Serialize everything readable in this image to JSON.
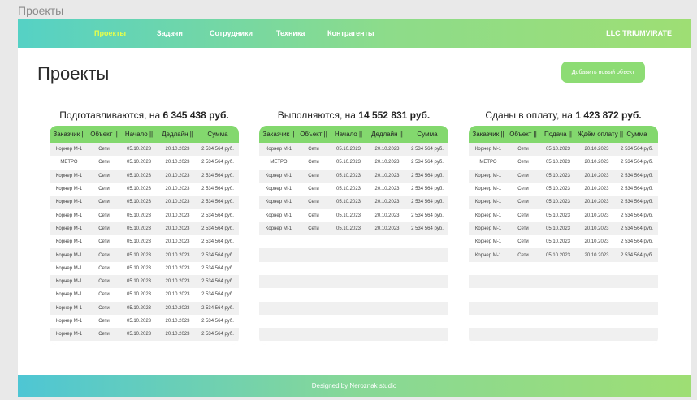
{
  "window_title": "Проекты",
  "nav": {
    "items": [
      {
        "label": "Проекты",
        "active": true
      },
      {
        "label": "Задачи",
        "active": false
      },
      {
        "label": "Сотрудники",
        "active": false
      },
      {
        "label": "Техника",
        "active": false
      },
      {
        "label": "Контрагенты",
        "active": false
      }
    ],
    "company": "LLC TRIUMVIRATE"
  },
  "page_title": "Проекты",
  "add_button": "Добавить новый объект",
  "panels": [
    {
      "title_prefix": "Подготавливаются, на ",
      "title_amount": "6 345 438 руб.",
      "columns": [
        "Заказчик ||",
        "Объект ||",
        "Начало ||",
        "Дедлайн ||",
        "Сумма"
      ],
      "total_rows": 16,
      "rows": [
        [
          "Корнер М-1",
          "Сети",
          "05.10.2023",
          "20.10.2023",
          "2 534 564 руб."
        ],
        [
          "МЕТРО",
          "Сети",
          "05.10.2023",
          "20.10.2023",
          "2 534 564 руб."
        ],
        [
          "Корнер М-1",
          "Сети",
          "05.10.2023",
          "20.10.2023",
          "2 534 564 руб."
        ],
        [
          "Корнер М-1",
          "Сети",
          "05.10.2023",
          "20.10.2023",
          "2 534 564 руб."
        ],
        [
          "Корнер М-1",
          "Сети",
          "05.10.2023",
          "20.10.2023",
          "2 534 564 руб."
        ],
        [
          "Корнер М-1",
          "Сети",
          "05.10.2023",
          "20.10.2023",
          "2 534 564 руб."
        ],
        [
          "Корнер М-1",
          "Сети",
          "05.10.2023",
          "20.10.2023",
          "2 534 564 руб."
        ],
        [
          "Корнер М-1",
          "Сети",
          "05.10.2023",
          "20.10.2023",
          "2 534 564 руб."
        ],
        [
          "Корнер М-1",
          "Сети",
          "05.10.2023",
          "20.10.2023",
          "2 534 564 руб."
        ],
        [
          "Корнер М-1",
          "Сети",
          "05.10.2023",
          "20.10.2023",
          "2 534 564 руб."
        ],
        [
          "Корнер М-1",
          "Сети",
          "05.10.2023",
          "20.10.2023",
          "2 534 564 руб."
        ],
        [
          "Корнер М-1",
          "Сети",
          "05.10.2023",
          "20.10.2023",
          "2 534 564 руб."
        ],
        [
          "Корнер М-1",
          "Сети",
          "05.10.2023",
          "20.10.2023",
          "2 534 564 руб."
        ],
        [
          "Корнер М-1",
          "Сети",
          "05.10.2023",
          "20.10.2023",
          "2 534 564 руб."
        ],
        [
          "Корнер М-1",
          "Сети",
          "05.10.2023",
          "20.10.2023",
          "2 534 564 руб."
        ]
      ]
    },
    {
      "title_prefix": "Выполняются, на ",
      "title_amount": "14 552 831 руб.",
      "columns": [
        "Заказчик ||",
        "Объект ||",
        "Начало ||",
        "Дедлайн ||",
        "Сумма"
      ],
      "total_rows": 16,
      "rows": [
        [
          "Корнер М-1",
          "Сети",
          "05.10.2023",
          "20.10.2023",
          "2 534 564 руб."
        ],
        [
          "МЕТРО",
          "Сети",
          "05.10.2023",
          "20.10.2023",
          "2 534 564 руб."
        ],
        [
          "Корнер М-1",
          "Сети",
          "05.10.2023",
          "20.10.2023",
          "2 534 564 руб."
        ],
        [
          "Корнер М-1",
          "Сети",
          "05.10.2023",
          "20.10.2023",
          "2 534 564 руб."
        ],
        [
          "Корнер М-1",
          "Сети",
          "05.10.2023",
          "20.10.2023",
          "2 534 564 руб."
        ],
        [
          "Корнер М-1",
          "Сети",
          "05.10.2023",
          "20.10.2023",
          "2 534 564 руб."
        ],
        [
          "Корнер М-1",
          "Сети",
          "05.10.2023",
          "20.10.2023",
          "2 534 564 руб."
        ]
      ]
    },
    {
      "title_prefix": "Сданы в оплату, на ",
      "title_amount": "1 423 872 руб.",
      "columns": [
        "Заказчик ||",
        "Объект ||",
        "Подача ||",
        "Ждём оплату ||",
        "Сумма"
      ],
      "total_rows": 16,
      "rows": [
        [
          "Корнер М-1",
          "Сети",
          "05.10.2023",
          "20.10.2023",
          "2 534 564 руб."
        ],
        [
          "МЕТРО",
          "Сети",
          "05.10.2023",
          "20.10.2023",
          "2 534 564 руб."
        ],
        [
          "Корнер М-1",
          "Сети",
          "05.10.2023",
          "20.10.2023",
          "2 534 564 руб."
        ],
        [
          "Корнер М-1",
          "Сети",
          "05.10.2023",
          "20.10.2023",
          "2 534 564 руб."
        ],
        [
          "Корнер М-1",
          "Сети",
          "05.10.2023",
          "20.10.2023",
          "2 534 564 руб."
        ],
        [
          "Корнер М-1",
          "Сети",
          "05.10.2023",
          "20.10.2023",
          "2 534 564 руб."
        ],
        [
          "Корнер М-1",
          "Сети",
          "05.10.2023",
          "20.10.2023",
          "2 534 564 руб."
        ],
        [
          "Корнер М-1",
          "Сети",
          "05.10.2023",
          "20.10.2023",
          "2 534 564 руб."
        ],
        [
          "Корнер М-1",
          "Сети",
          "05.10.2023",
          "20.10.2023",
          "2 534 564 руб."
        ]
      ]
    }
  ],
  "footer": "Designed by Neroznak studio",
  "colors": {
    "nav_gradient_start": "#55d1c5",
    "nav_gradient_end": "#9ede74",
    "active_nav": "#e7ff4b",
    "table_header": "#83d86e",
    "button": "#8ddc74"
  }
}
